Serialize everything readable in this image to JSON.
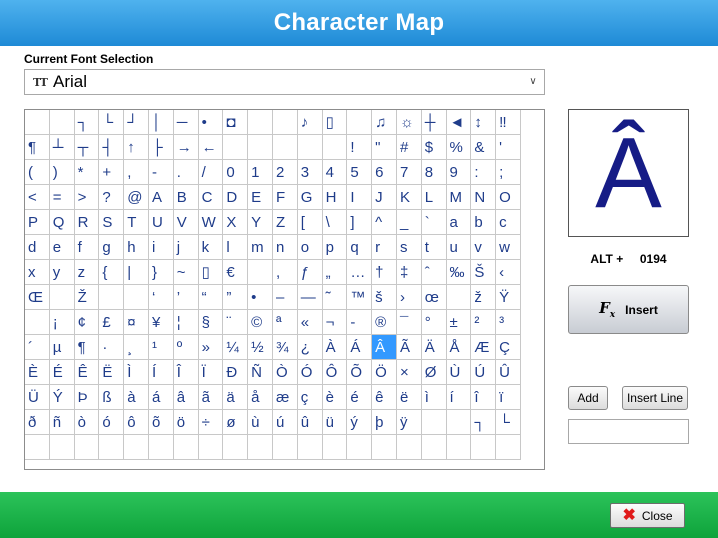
{
  "window": {
    "title": "Character Map"
  },
  "font": {
    "label": "Current Font Selection",
    "icon": "font-tt-icon",
    "value": "Arial"
  },
  "grid": {
    "selected": [
      9,
      14
    ],
    "rows": [
      [
        "",
        "",
        "┐",
        "└",
        "┘",
        "│",
        "─",
        "•",
        "◘",
        "",
        "",
        "♪",
        "▯",
        "",
        "♫",
        "☼",
        "┼",
        "◄",
        "↕",
        "‼"
      ],
      [
        "¶",
        "┴",
        "┬",
        "┤",
        "↑",
        "├",
        "→",
        "←",
        "",
        "",
        "",
        "",
        "",
        "!",
        "\"",
        "#",
        "$",
        "%",
        "&",
        "'"
      ],
      [
        "(",
        ")",
        "*",
        "+",
        ",",
        "-",
        ".",
        "/",
        "0",
        "1",
        "2",
        "3",
        "4",
        "5",
        "6",
        "7",
        "8",
        "9",
        ":",
        ";"
      ],
      [
        "<",
        "=",
        ">",
        "?",
        "@",
        "A",
        "B",
        "C",
        "D",
        "E",
        "F",
        "G",
        "H",
        "I",
        "J",
        "K",
        "L",
        "M",
        "N",
        "O"
      ],
      [
        "P",
        "Q",
        "R",
        "S",
        "T",
        "U",
        "V",
        "W",
        "X",
        "Y",
        "Z",
        "[",
        "\\",
        "]",
        "^",
        "_",
        "`",
        "a",
        "b",
        "c"
      ],
      [
        "d",
        "e",
        "f",
        "g",
        "h",
        "i",
        "j",
        "k",
        "l",
        "m",
        "n",
        "o",
        "p",
        "q",
        "r",
        "s",
        "t",
        "u",
        "v",
        "w"
      ],
      [
        "x",
        "y",
        "z",
        "{",
        "|",
        "}",
        "~",
        "▯",
        "€",
        "",
        ",",
        "ƒ",
        "„",
        "…",
        "†",
        "‡",
        "ˆ",
        "‰",
        "Š",
        "‹"
      ],
      [
        "Œ",
        "",
        "Ž",
        "",
        "",
        "‘",
        "’",
        "“",
        "”",
        "•",
        "–",
        "—",
        "˜",
        "™",
        "š",
        "›",
        "œ",
        "",
        "ž",
        "Ÿ"
      ],
      [
        "",
        "¡",
        "¢",
        "£",
        "¤",
        "¥",
        "¦",
        "§",
        "¨",
        "©",
        "ª",
        "«",
        "¬",
        "-",
        "®",
        "¯",
        "°",
        "±",
        "²",
        "³"
      ],
      [
        "´",
        "µ",
        "¶",
        "·",
        "¸",
        "¹",
        "º",
        "»",
        "¼",
        "½",
        "¾",
        "¿",
        "À",
        "Á",
        "Â",
        "Ã",
        "Ä",
        "Å",
        "Æ",
        "Ç"
      ],
      [
        "È",
        "É",
        "Ê",
        "Ë",
        "Ì",
        "Í",
        "Î",
        "Ï",
        "Ð",
        "Ñ",
        "Ò",
        "Ó",
        "Ô",
        "Õ",
        "Ö",
        "×",
        "Ø",
        "Ù",
        "Ú",
        "Û"
      ],
      [
        "Ü",
        "Ý",
        "Þ",
        "ß",
        "à",
        "á",
        "â",
        "ã",
        "ä",
        "å",
        "æ",
        "ç",
        "è",
        "é",
        "ê",
        "ë",
        "ì",
        "í",
        "î",
        "ï"
      ],
      [
        "ð",
        "ñ",
        "ò",
        "ó",
        "ô",
        "õ",
        "ö",
        "÷",
        "ø",
        "ù",
        "ú",
        "û",
        "ü",
        "ý",
        "þ",
        "ÿ",
        "",
        "",
        "┐",
        "└"
      ],
      [
        "",
        "",
        "",
        "",
        "",
        "",
        "",
        "",
        "",
        "",
        "",
        "",
        "",
        "",
        "",
        "",
        "",
        "",
        "",
        ""
      ]
    ]
  },
  "preview": {
    "glyph": "Â",
    "alt_label": "ALT +",
    "alt_code": "0194"
  },
  "buttons": {
    "insert_icon": "fx-icon",
    "insert_icon_text": "F",
    "insert_icon_sub": "x",
    "insert": "Insert",
    "add": "Add",
    "insert_line": "Insert Line",
    "close": "Close",
    "close_icon": "close-x-icon",
    "close_icon_text": "✖"
  },
  "line_field": {
    "value": ""
  },
  "colors": {
    "title_bar": "#1e8ad6",
    "bottom_bar": "#0ea33b",
    "selection": "#3399ff",
    "glyph": "#161c86"
  }
}
